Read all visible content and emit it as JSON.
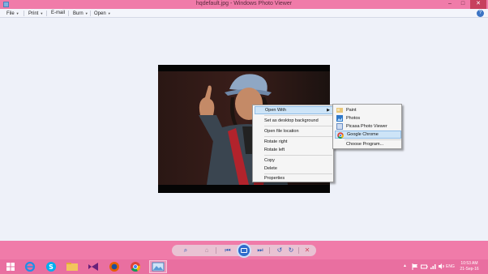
{
  "window": {
    "title": "hqdefault.jpg - Windows Photo Viewer",
    "app_icon": "photo-viewer-icon",
    "controls": {
      "minimize": "–",
      "maximize": "□",
      "close": "✕"
    }
  },
  "menubar": {
    "items": [
      {
        "label": "File"
      },
      {
        "label": "Print"
      },
      {
        "label": "E-mail"
      },
      {
        "label": "Burn"
      },
      {
        "label": "Open"
      }
    ],
    "help_icon": "?"
  },
  "context_menu": {
    "items": [
      {
        "label": "Open With",
        "submenu": true,
        "highlighted": true
      },
      {
        "label": "Set as desktop background"
      },
      {
        "label": "Open file location"
      },
      {
        "label": "Rotate right"
      },
      {
        "label": "Rotate left"
      },
      {
        "label": "Copy"
      },
      {
        "label": "Delete"
      },
      {
        "label": "Properties"
      }
    ],
    "submenu_arrow": "▶"
  },
  "open_with_submenu": {
    "items": [
      {
        "label": "Paint",
        "icon": "paint-icon"
      },
      {
        "label": "Photos",
        "icon": "photos-icon"
      },
      {
        "label": "Picasa Photo Viewer",
        "icon": "picasa-icon"
      },
      {
        "label": "Google Chrome",
        "icon": "chrome-icon",
        "highlighted": true
      },
      {
        "label": "Choose Program..."
      }
    ]
  },
  "viewer_controls": {
    "zoom": "⌕",
    "actual_size": "⌂",
    "previous": "⏮",
    "next": "⏭",
    "rotate_left": "↺",
    "rotate_right": "↻",
    "delete": "✕"
  },
  "taskbar": {
    "apps": [
      "start-icon",
      "ie-icon",
      "skype-icon",
      "file-explorer-icon",
      "visual-studio-icon",
      "firefox-icon",
      "chrome-icon",
      "photo-viewer-icon"
    ],
    "language": "ENG",
    "time": "10:53 AM",
    "date": "21-Sep-16"
  },
  "colors": {
    "accent_pink": "#f07ba9",
    "taskbar_pink": "#e96fa0",
    "menu_highlight": "#cde4f7"
  }
}
